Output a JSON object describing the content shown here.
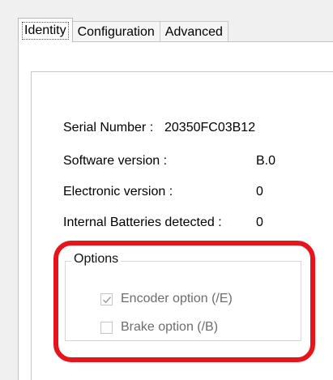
{
  "tabs": [
    {
      "label": "Identity",
      "active": true
    },
    {
      "label": "Configuration",
      "active": false
    },
    {
      "label": "Advanced",
      "active": false
    }
  ],
  "identity": {
    "serial_label": "Serial Number :",
    "serial_value": "20350FC03B12",
    "software_label": "Software version :",
    "software_value": "B.0",
    "electronic_label": "Electronic version :",
    "electronic_value": "0",
    "batteries_label": "Internal Batteries detected :",
    "batteries_value": "0"
  },
  "options": {
    "title": "Options",
    "encoder": {
      "label": "Encoder option (/E)",
      "checked": true,
      "enabled": false
    },
    "brake": {
      "label": "Brake option (/B)",
      "checked": false,
      "enabled": false
    }
  },
  "colors": {
    "highlight": "#e8141c",
    "disabled_text": "#6d6d6d"
  }
}
